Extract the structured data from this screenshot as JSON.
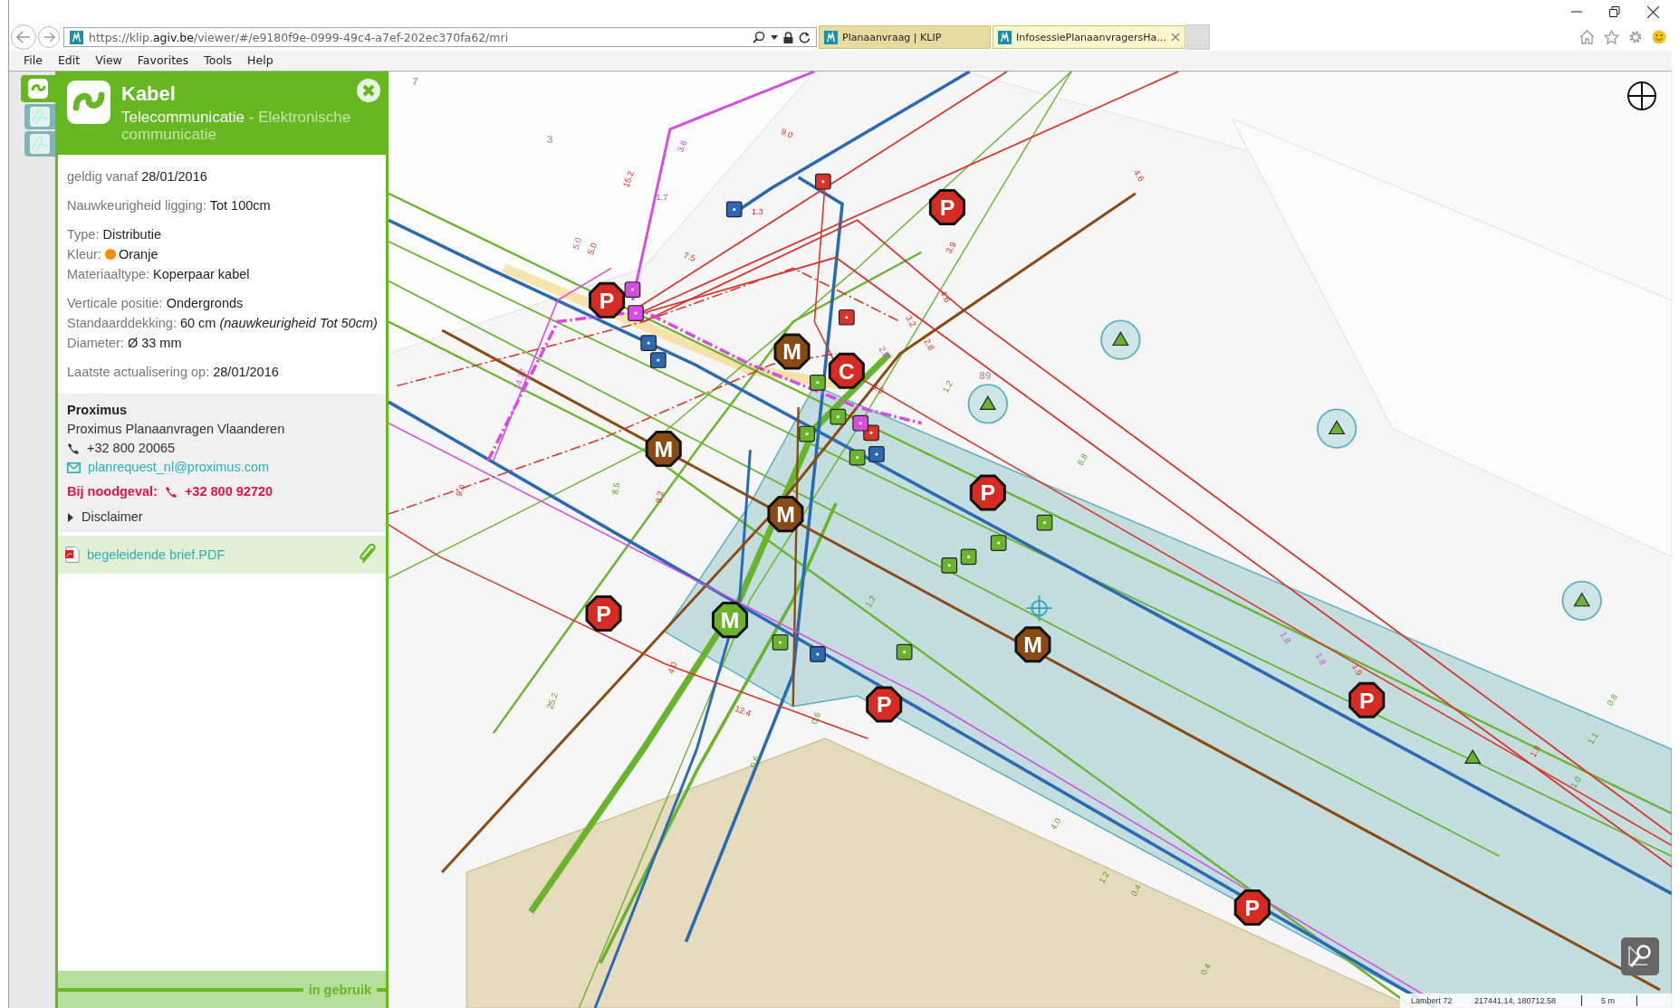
{
  "browser": {
    "url": "https://klip.**agiv.be**/viewer/#/e9180f9e-0999-49c4-a7ef-202ec370fa62/mri",
    "tabs": [
      {
        "title": "Planaanvraag | KLIP",
        "selected": false
      },
      {
        "title": "InfosessiePlanaanvragersHa...",
        "selected": true
      }
    ],
    "menu": [
      "File",
      "Edit",
      "View",
      "Favorites",
      "Tools",
      "Help"
    ]
  },
  "tool_strip": [
    {
      "selected": true
    },
    {
      "selected": false
    },
    {
      "selected": false
    }
  ],
  "panel": {
    "title": "Kabel",
    "subtitle": "Telecommunicatie",
    "subtitle_suffix": "- Elektronische communicatie",
    "detail_groups": [
      [
        {
          "label": "geldig vanaf",
          "value": "28/01/2016"
        }
      ],
      [
        {
          "label": "Nauwkeurigheid ligging:",
          "value": "Tot 100cm"
        }
      ],
      [
        {
          "label": "Type:",
          "value": "Distributie"
        },
        {
          "label": "Kleur:",
          "value": "Oranje",
          "color": "#ff8c00"
        },
        {
          "label": "Materiaaltype:",
          "value": "Koperpaar kabel"
        }
      ],
      [
        {
          "label": "Verticale positie:",
          "value": "Ondergronds"
        },
        {
          "label": "Standaarddekking:",
          "value": "60 cm *(nauwkeurigheid Tot 50cm)*"
        },
        {
          "label": "Diameter:",
          "value": "Ø 33 mm"
        }
      ],
      [
        {
          "label": "Laatste actualisering op:",
          "value": "28/01/2016"
        }
      ]
    ],
    "contact": {
      "company": "Proximus",
      "department": "Proximus Planaanvragen Vlaanderen",
      "phone": "+32 800 20065",
      "email": "planrequest_nl@proximus.com",
      "emergency_label": "Bij noodgeval:",
      "emergency_phone": "+32 800 92720",
      "disclaimer": "Disclaimer",
      "disclaimer_expanded": false
    },
    "attachment": "begeleidende brief.PDF",
    "footer": "in gebruik"
  },
  "map": {
    "markers": [
      {
        "letter": "P",
        "color": "#d62b22"
      },
      {
        "letter": "P",
        "color": "#d62b22"
      },
      {
        "letter": "M",
        "color": "#8a4a14"
      },
      {
        "letter": "C",
        "color": "#d62b22"
      },
      {
        "letter": "M",
        "color": "#8a4a14"
      },
      {
        "letter": "P",
        "color": "#d62b22"
      },
      {
        "letter": "M",
        "color": "#8a4a14"
      },
      {
        "letter": "P",
        "color": "#d62b22"
      },
      {
        "letter": "M",
        "color": "#6ab42d"
      },
      {
        "letter": "M",
        "color": "#8a4a14"
      },
      {
        "letter": "P",
        "color": "#d62b22"
      },
      {
        "letter": "P",
        "color": "#d62b22"
      },
      {
        "letter": "P",
        "color": "#d62b22"
      }
    ],
    "dimension_labels": [
      "9.0",
      "3.6",
      "15.2",
      "1.7",
      "5.0",
      "5.0",
      "7.5",
      "4.6",
      "3.9",
      "4.6",
      "3.2",
      "2.8",
      "2.8",
      "3.3",
      "1.2",
      "14.77",
      "9.0",
      "8.5",
      "8.2",
      "25.2",
      "12.4",
      "4.0",
      "0.6",
      "0.6",
      "1.2",
      "1.8",
      "1.8",
      "1.9",
      "0.8",
      "1.1",
      "1.8",
      "1.0",
      "4.0",
      "1.2",
      "0.4",
      "0.4",
      "6.8",
      "1.3"
    ],
    "parcel_labels": [
      "7",
      "3",
      "89"
    ],
    "status": {
      "projection": "Lambert 72",
      "coordinates": "217441.14, 180712.58",
      "scale": "5 m"
    }
  }
}
